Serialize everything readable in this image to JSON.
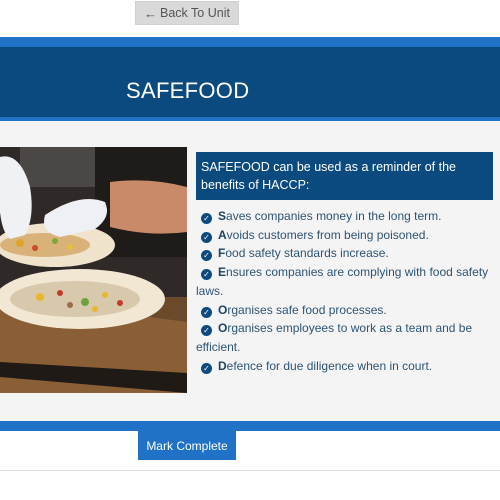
{
  "nav": {
    "back_label": "Back To Unit",
    "back_icon": "arrow-left-icon"
  },
  "header": {
    "title": "SAFEFOOD"
  },
  "content": {
    "intro": "SAFEFOOD can be used as a reminder of the benefits of HACCP:",
    "items": [
      {
        "initial": "S",
        "rest": "aves companies money in the long term."
      },
      {
        "initial": "A",
        "rest": "voids customers from being poisoned."
      },
      {
        "initial": "F",
        "rest": "ood safety standards increase."
      },
      {
        "initial": "E",
        "rest": "nsures companies are complying with food safety laws."
      },
      {
        "initial": "O",
        "rest": "rganises safe food processes."
      },
      {
        "initial": "O",
        "rest": "rganises employees to work as a team and be efficient."
      },
      {
        "initial": "D",
        "rest": "efence for due diligence when in court."
      }
    ],
    "image_subject": "gloved hands assembling food wraps on a wooden board"
  },
  "footer": {
    "mark_complete_label": "Mark Complete"
  },
  "colors": {
    "accent_blue": "#1f72c6",
    "navy": "#0b4a7e",
    "text_blue": "#2d5475",
    "button_gray": "#d9d9d9"
  }
}
